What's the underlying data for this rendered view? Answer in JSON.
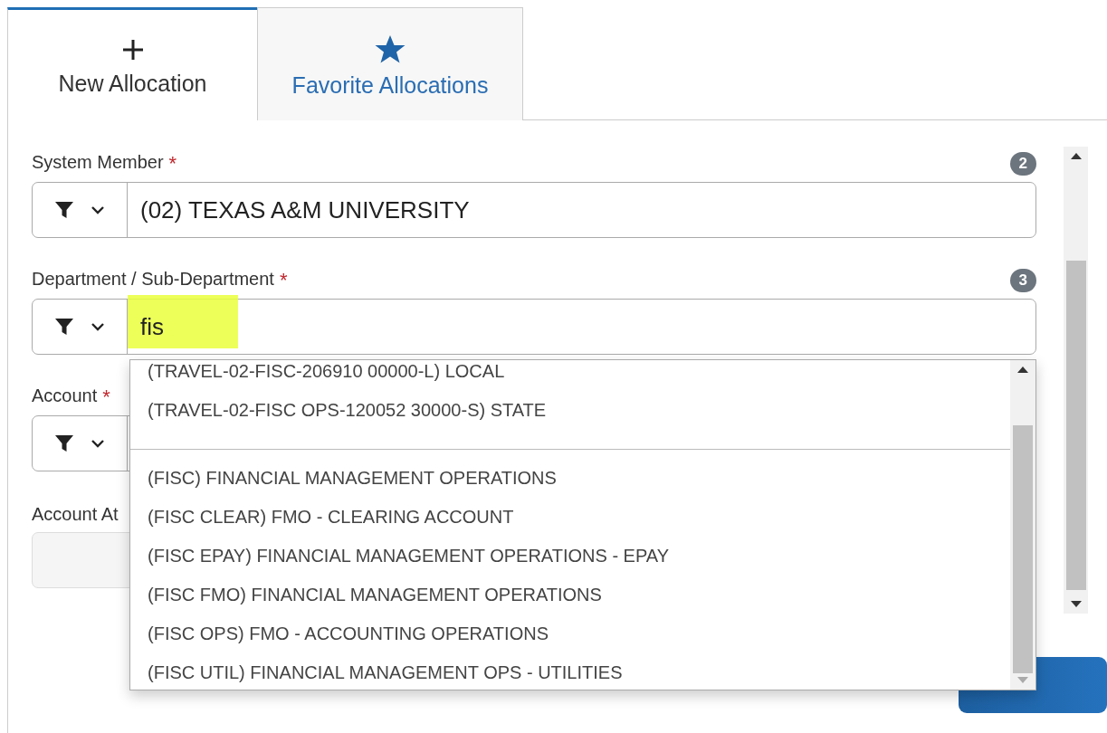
{
  "tabs": [
    {
      "label": "New Allocation",
      "kind": "plus",
      "selected": true
    },
    {
      "label": "Favorite Allocations",
      "kind": "star",
      "selected": false
    }
  ],
  "fields": [
    {
      "label": "System Member",
      "required_mark": "*",
      "badge": "2",
      "kind": "filter",
      "value": "(02) TEXAS A&M UNIVERSITY"
    },
    {
      "label": "Department / Sub-Department",
      "required_mark": "*",
      "badge": "3",
      "kind": "filter",
      "value": "fis",
      "highlighted": true
    },
    {
      "label": "Account",
      "required_mark": "*",
      "kind": "filter"
    },
    {
      "label": "Account At",
      "kind": "plain",
      "disabled": true
    }
  ],
  "dropdown": {
    "groups": [
      {
        "options": [
          "(TRAVEL-02-FISC-206910 00000-L) LOCAL",
          "(TRAVEL-02-FISC OPS-120052 30000-S) STATE"
        ]
      },
      {
        "options": [
          "(FISC) FINANCIAL MANAGEMENT OPERATIONS",
          "(FISC CLEAR) FMO - CLEARING ACCOUNT",
          "(FISC EPAY) FINANCIAL MANAGEMENT OPERATIONS - EPAY",
          "(FISC FMO) FINANCIAL MANAGEMENT OPERATIONS",
          "(FISC OPS) FMO - ACCOUNTING OPERATIONS",
          "(FISC UTIL) FINANCIAL MANAGEMENT OPS - UTILITIES"
        ]
      }
    ]
  }
}
